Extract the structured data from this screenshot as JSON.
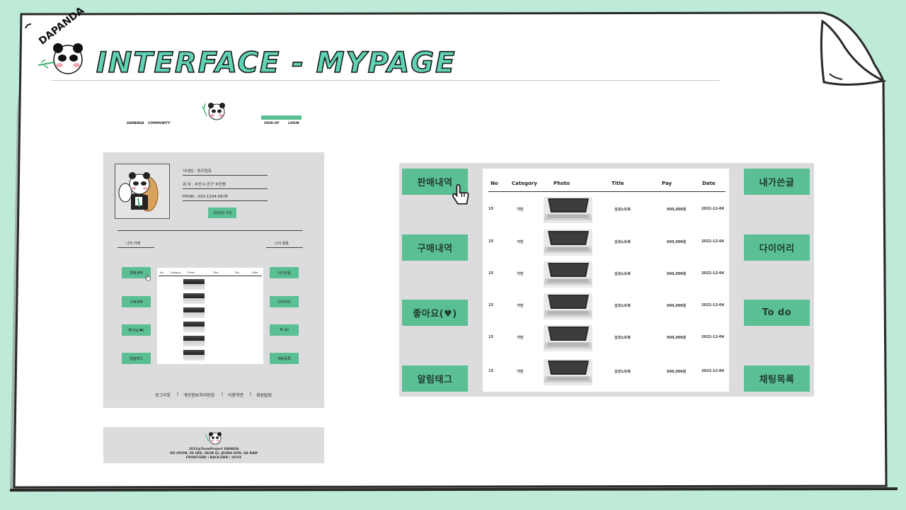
{
  "slide": {
    "logo_text": "DAPANDA",
    "title": "INTERFACE  -  MYPAGE"
  },
  "mockup": {
    "nav": {
      "left": [
        "DAPANDA",
        "COMMUNITY"
      ],
      "signup": "SIGN-UP",
      "login": "LOGIN"
    },
    "profile": {
      "nickname": "닉네임 : 위즈덤유",
      "address": "위   치 : 부산시 진구 부전동",
      "phone": "PHON : 010-1234-5678",
      "edit_button": "회원정보 수정"
    },
    "section_left": "나의 거래",
    "section_right": "나의 활동",
    "left_buttons": [
      "판매내역",
      "구매내역",
      "좋아요(♥)",
      "알림태그"
    ],
    "right_buttons": [
      "내가쓴글",
      "다이어리",
      "To do",
      "채팅목록"
    ],
    "table_headers": [
      "No",
      "Category",
      "Photo",
      "Title",
      "Pay",
      "Date"
    ],
    "footer_links": [
      "로그아웃",
      "|",
      "개인정보처리방침",
      "|",
      "이용약관",
      "|",
      "회원탈퇴"
    ],
    "footer": {
      "line1": "2022@TeamProject DAPADA",
      "line2": "DO HOON, SE HEE, SEUB GI, JEONG EUN, GA RAM",
      "line3": "FRONT-END | BACK-END | UI/UX"
    }
  },
  "detail": {
    "left_buttons": [
      "판매내역",
      "구매내역",
      "좋아요(♥)",
      "알림태그"
    ],
    "right_buttons": [
      "내가쓴글",
      "다이어리",
      "To do",
      "채팅목록"
    ],
    "table_headers": [
      "No",
      "Category",
      "Photo",
      "Title",
      "Pay",
      "Date"
    ],
    "rows": [
      {
        "no": "15",
        "category": "가전",
        "title": "삼성노트북",
        "pay": "600,000원",
        "date": "2022-12-04"
      },
      {
        "no": "15",
        "category": "가전",
        "title": "삼성노트북",
        "pay": "600,000원",
        "date": "2022-12-04"
      },
      {
        "no": "15",
        "category": "가전",
        "title": "삼성노트북",
        "pay": "600,000원",
        "date": "2022-12-04"
      },
      {
        "no": "15",
        "category": "가전",
        "title": "삼성노트북",
        "pay": "600,000원",
        "date": "2022-12-04"
      },
      {
        "no": "15",
        "category": "가전",
        "title": "삼성노트북",
        "pay": "600,000원",
        "date": "2022-12-04"
      },
      {
        "no": "15",
        "category": "가전",
        "title": "삼성노트북",
        "pay": "600,000원",
        "date": "2022-12-04"
      }
    ]
  }
}
